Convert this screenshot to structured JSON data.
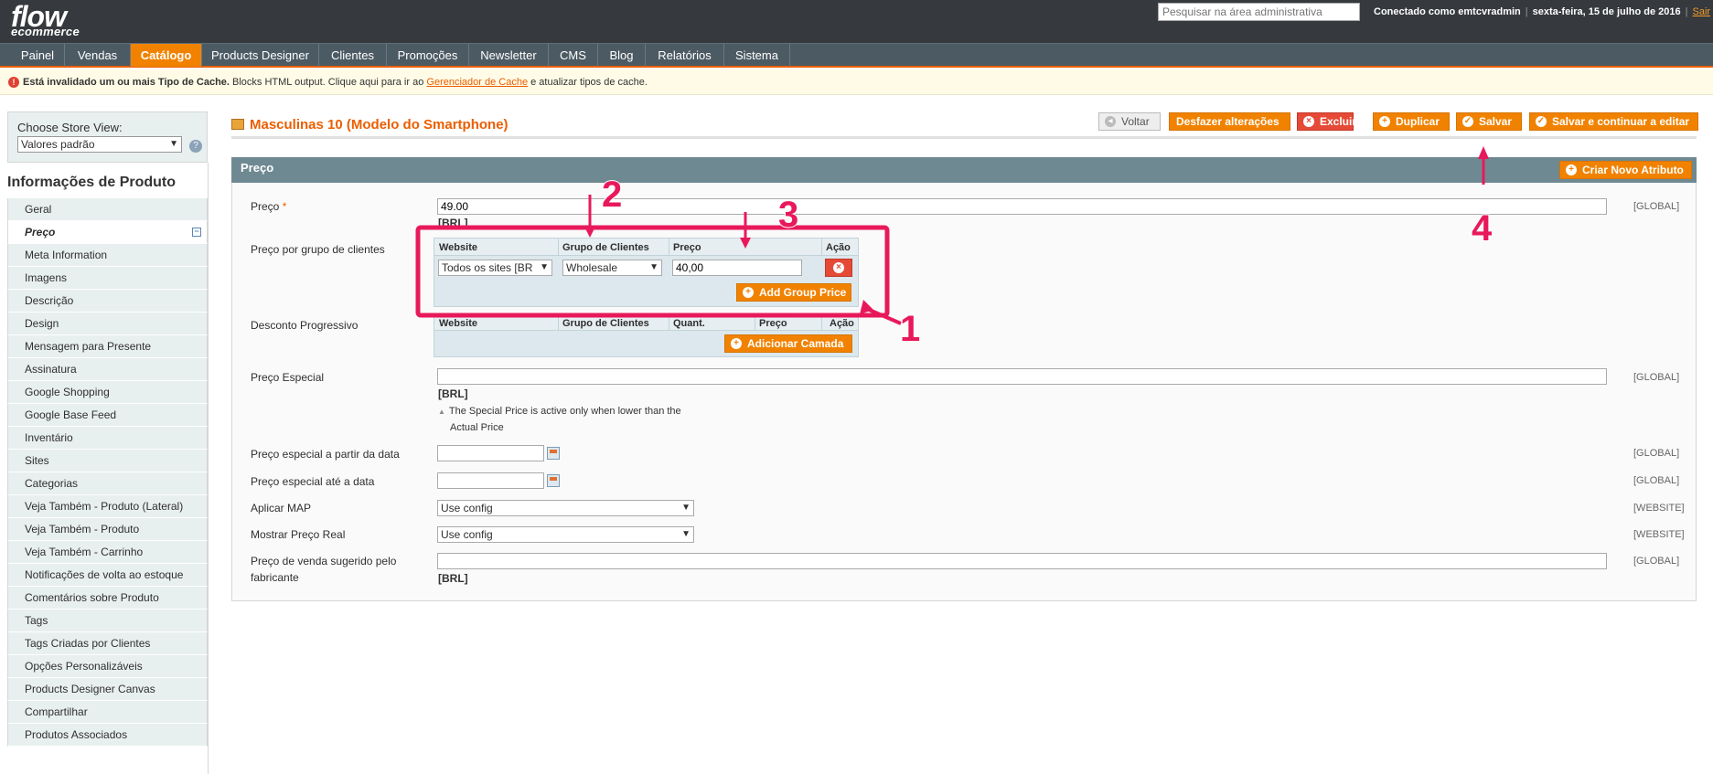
{
  "header": {
    "logo_line1": "flow",
    "logo_line2": "ecommerce",
    "search_placeholder": "Pesquisar na área administrativa",
    "logged_in": "Conectado como emtcvradmin",
    "date": "sexta-feira, 15 de julho de 2016",
    "logout": "Sair"
  },
  "nav": {
    "items": [
      {
        "label": "Painel"
      },
      {
        "label": "Vendas"
      },
      {
        "label": "Catálogo"
      },
      {
        "label": "Products Designer"
      },
      {
        "label": "Clientes"
      },
      {
        "label": "Promoções"
      },
      {
        "label": "Newsletter"
      },
      {
        "label": "CMS"
      },
      {
        "label": "Blog"
      },
      {
        "label": "Relatórios"
      },
      {
        "label": "Sistema"
      }
    ],
    "active": "Catálogo"
  },
  "message": {
    "bold": "Está invalidado um ou mais Tipo de Cache.",
    "text": " Blocks HTML output. Clique aqui para ir ao ",
    "link": "Gerenciador de Cache",
    "after": " e atualizar tipos de cache."
  },
  "sidebar": {
    "store_view_label": "Choose Store View:",
    "store_view_value": "Valores padrão",
    "title": "Informações de Produto",
    "items": [
      {
        "label": "Geral"
      },
      {
        "label": "Preço"
      },
      {
        "label": "Meta Information"
      },
      {
        "label": "Imagens"
      },
      {
        "label": "Descrição"
      },
      {
        "label": "Design"
      },
      {
        "label": "Mensagem para Presente"
      },
      {
        "label": "Assinatura"
      },
      {
        "label": "Google Shopping"
      },
      {
        "label": "Google Base Feed"
      },
      {
        "label": "Inventário"
      },
      {
        "label": "Sites"
      },
      {
        "label": "Categorias"
      },
      {
        "label": "Veja Também - Produto (Lateral)"
      },
      {
        "label": "Veja Também - Produto"
      },
      {
        "label": "Veja Também - Carrinho"
      },
      {
        "label": "Notificações de volta ao estoque"
      },
      {
        "label": "Comentários sobre Produto"
      },
      {
        "label": "Tags"
      },
      {
        "label": "Tags Criadas por Clientes"
      },
      {
        "label": "Opções Personalizáveis"
      },
      {
        "label": "Products Designer Canvas"
      },
      {
        "label": "Compartilhar"
      },
      {
        "label": "Produtos Associados"
      }
    ],
    "active": "Preço"
  },
  "page": {
    "title": "Masculinas 10 (Modelo do Smartphone)",
    "buttons": {
      "back": "Voltar",
      "reset": "Desfazer alterações",
      "delete": "Excluir",
      "duplicate": "Duplicar",
      "save": "Salvar",
      "save_continue": "Salvar e continuar a editar"
    }
  },
  "section": {
    "title": "Preço",
    "new_attr_button": "Criar Novo Atributo",
    "price": {
      "label": "Preço",
      "required_mark": "*",
      "value": "49.00",
      "currency": "[BRL]",
      "scope": "[GLOBAL]"
    },
    "group_price": {
      "label": "Preço por grupo de clientes",
      "columns": [
        "Website",
        "Grupo de Clientes",
        "Preço",
        "Ação"
      ],
      "row": {
        "website": "Todos os sites [BR",
        "group": "Wholesale",
        "price": "40,00"
      },
      "add_button": "Add Group Price"
    },
    "tier_price": {
      "label": "Desconto Progressivo",
      "columns": [
        "Website",
        "Grupo de Clientes",
        "Quant.",
        "Preço",
        "Ação"
      ],
      "add_button": "Adicionar Camada"
    },
    "special_price": {
      "label": "Preço Especial",
      "value": "",
      "currency": "[BRL]",
      "note_line1": "The Special Price is active only when lower than the",
      "note_line2": "Actual Price",
      "scope": "[GLOBAL]"
    },
    "special_from": {
      "label": "Preço especial a partir da data",
      "value": "",
      "scope": "[GLOBAL]"
    },
    "special_to": {
      "label": "Preço especial até a data",
      "value": "",
      "scope": "[GLOBAL]"
    },
    "map": {
      "label": "Aplicar MAP",
      "value": "Use config",
      "scope": "[WEBSITE]"
    },
    "show_price": {
      "label": "Mostrar Preço Real",
      "value": "Use config",
      "scope": "[WEBSITE]"
    },
    "msrp": {
      "label_line1": "Preço de venda sugerido pelo",
      "label_line2": "fabricante",
      "value": "",
      "currency": "[BRL]",
      "scope": "[GLOBAL]"
    }
  },
  "annotations": [
    "1",
    "2",
    "3",
    "4"
  ],
  "colors": {
    "accent": "#eb5e00",
    "highlight": "#e8195b",
    "header": "#36393d",
    "nav": "#4c5a63",
    "section": "#6f8992"
  }
}
